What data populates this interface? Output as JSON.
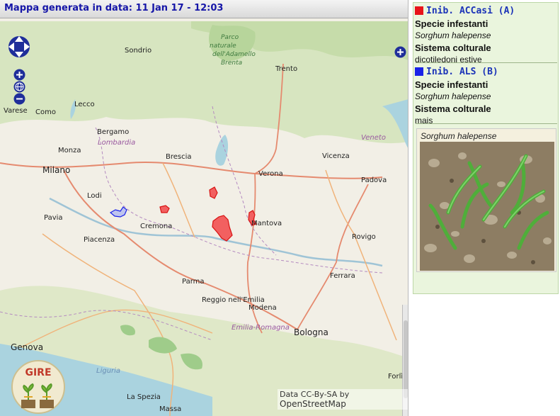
{
  "banner": "Mappa generata in data: 11 Jan 17 - 12:03",
  "map": {
    "cities": [
      "Sondrio",
      "Lecco",
      "Como",
      "Varese",
      "Bergamo",
      "Monza",
      "Milano",
      "Lodi",
      "Pavia",
      "Piacenza",
      "Cremona",
      "Brescia",
      "Verona",
      "Vicenza",
      "Padova",
      "Mantova",
      "Rovigo",
      "Ferrara",
      "Parma",
      "Reggio nell'Emilia",
      "Modena",
      "Bologna",
      "Genova",
      "La Spezia",
      "Massa",
      "Trento",
      "Forlì"
    ],
    "regions": [
      "Lombardia",
      "Veneto",
      "Emilia-Romagna",
      "Liguria"
    ],
    "park": [
      "Parco",
      "naturale",
      "dell'Adamello",
      "Brenta"
    ],
    "controls": {
      "pan": "pan-control",
      "zoom_in": "+",
      "zoom_out": "−",
      "world": "world-icon",
      "layers": "+"
    },
    "attribution": {
      "prefix": "Data CC-By-SA by ",
      "brand": "OpenStreetMap"
    },
    "logo": "GIRE"
  },
  "legend": {
    "entries": [
      {
        "swatch": "#e8141a",
        "title": "Inib. ACCasi (A)",
        "label1": "Specie infestanti",
        "value1": "Sorghum halepense",
        "label2": "Sistema colturale",
        "value2": "dicotiledoni estive"
      },
      {
        "swatch": "#1a22e8",
        "title": "Inib. ALS (B)",
        "label1": "Specie infestanti",
        "value1": "Sorghum halepense",
        "label2": "Sistema colturale",
        "value2": "mais"
      }
    ],
    "photo_caption": "Sorghum halepense"
  },
  "colors": {
    "area_a": "#e8141a",
    "area_b": "#1a22e8",
    "legend_bg": "#eaf5dd",
    "banner_text": "#1616a8"
  }
}
